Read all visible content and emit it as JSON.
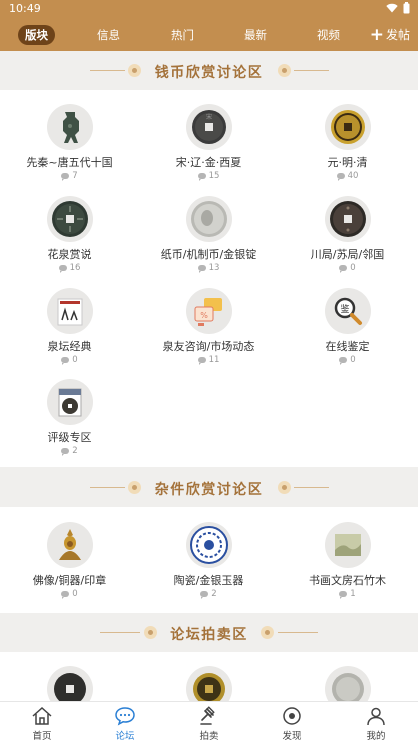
{
  "status": {
    "time": "10:49"
  },
  "tabs": [
    {
      "label": "版块"
    },
    {
      "label": "信息"
    },
    {
      "label": "热门"
    },
    {
      "label": "最新"
    },
    {
      "label": "视频"
    }
  ],
  "post_label": "发帖",
  "sections": [
    {
      "title": "钱币欣赏讨论区",
      "items": [
        {
          "label": "先秦~唐五代十国",
          "count": "7",
          "icon": "spade-coin-icon"
        },
        {
          "label": "宋·辽·金·西夏",
          "count": "15",
          "icon": "song-coin-icon"
        },
        {
          "label": "元·明·清",
          "count": "40",
          "icon": "qing-coin-icon"
        },
        {
          "label": "花泉赏说",
          "count": "16",
          "icon": "flower-coin-icon"
        },
        {
          "label": "纸币/机制币/金银锭",
          "count": "13",
          "icon": "silver-dollar-icon"
        },
        {
          "label": "川局/苏局/邻国",
          "count": "0",
          "icon": "provincial-coin-icon"
        },
        {
          "label": "泉坛经典",
          "count": "0",
          "icon": "classic-book-icon"
        },
        {
          "label": "泉友咨询/市场动态",
          "count": "11",
          "icon": "consult-chat-icon"
        },
        {
          "label": "在线鉴定",
          "count": "0",
          "icon": "appraisal-magnifier-icon"
        },
        {
          "label": "评级专区",
          "count": "2",
          "icon": "graded-coin-icon"
        }
      ]
    },
    {
      "title": "杂件欣赏讨论区",
      "items": [
        {
          "label": "佛像/铜器/印章",
          "count": "0",
          "icon": "buddha-statue-icon"
        },
        {
          "label": "陶瓷/金银玉器",
          "count": "2",
          "icon": "porcelain-plate-icon"
        },
        {
          "label": "书画文房石竹木",
          "count": "1",
          "icon": "painting-scroll-icon"
        }
      ]
    },
    {
      "title": "论坛拍卖区",
      "items": [
        {
          "label": "",
          "count": "",
          "icon": "auction-coin-icon"
        },
        {
          "label": "",
          "count": "",
          "icon": "auction-gold-coin-icon"
        },
        {
          "label": "",
          "count": "",
          "icon": "auction-silver-coin-icon"
        }
      ]
    }
  ],
  "bottom_nav": [
    {
      "label": "首页",
      "icon": "home-icon"
    },
    {
      "label": "论坛",
      "icon": "forum-chat-icon",
      "active": true
    },
    {
      "label": "拍卖",
      "icon": "auction-hammer-icon"
    },
    {
      "label": "发现",
      "icon": "discover-compass-icon"
    },
    {
      "label": "我的",
      "icon": "profile-icon"
    }
  ],
  "colors": {
    "brand": "#c38e4f",
    "active_tab": "#6e4319",
    "section_title": "#a4723a",
    "active_nav": "#2a7fd4"
  }
}
